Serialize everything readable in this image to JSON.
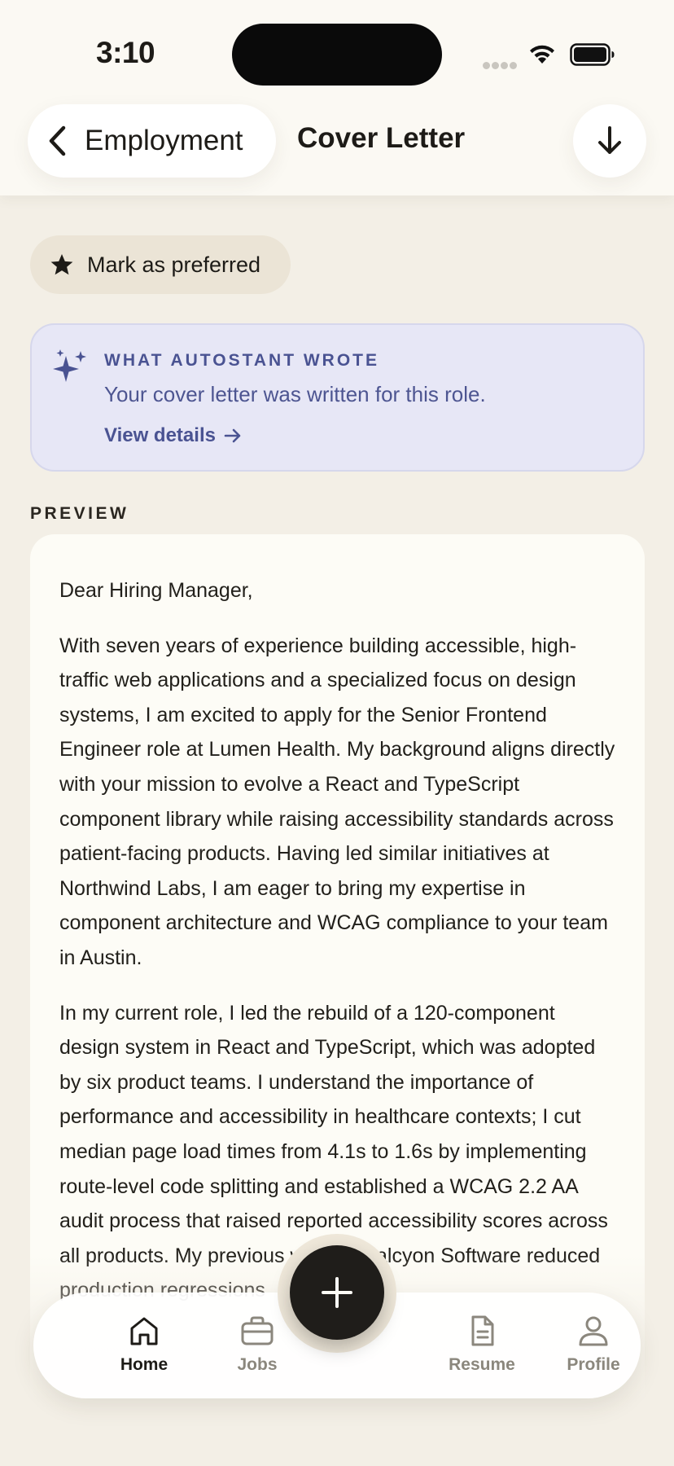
{
  "status_bar": {
    "time": "3:10"
  },
  "header": {
    "back_label": "Employment",
    "title": "Cover Letter",
    "download_icon": "arrow-down-icon"
  },
  "preferred_chip": {
    "label": "Mark as preferred",
    "icon": "star-icon"
  },
  "autostant_card": {
    "eyebrow": "WHAT AUTOSTANT WROTE",
    "description": "Your cover letter was written for this role.",
    "link_label": "View details",
    "icon": "sparkle-icon",
    "accent_color": "#4a5392"
  },
  "preview": {
    "section_label": "PREVIEW",
    "salutation": "Dear Hiring Manager,",
    "paragraphs": [
      "With seven years of experience building accessible, high-traffic web applications and a specialized focus on design systems, I am excited to apply for the Senior Frontend Engineer role at Lumen Health. My background aligns directly with your mission to evolve a React and TypeScript component library while raising accessibility standards across patient-facing products. Having led similar initiatives at Northwind Labs, I am eager to bring my expertise in component architecture and WCAG compliance to your team in Austin.",
      "In my current role, I led the rebuild of a 120-component design system in React and TypeScript, which was adopted by six product teams. I understand the importance of performance and accessibility in healthcare contexts; I cut median page load times from 4.1s to 1.6s by implementing route-level code splitting and established a WCAG 2.2 AA audit process that raised reported accessibility scores across all products. My previous work at Halcyon Software reduced production regressions"
    ]
  },
  "tab_bar": {
    "tabs": [
      {
        "label": "Home",
        "icon": "home-icon",
        "active": true
      },
      {
        "label": "Jobs",
        "icon": "briefcase-icon",
        "active": false
      },
      {
        "label": "Resume",
        "icon": "document-icon",
        "active": false
      },
      {
        "label": "Profile",
        "icon": "person-icon",
        "active": false
      }
    ],
    "fab_icon": "plus-icon"
  }
}
